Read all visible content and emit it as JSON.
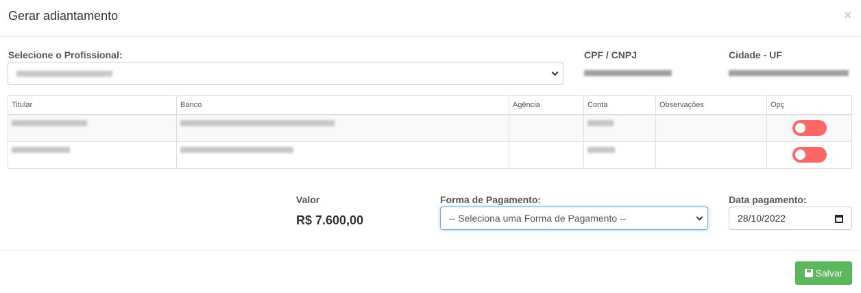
{
  "modal": {
    "title": "Gerar adiantamento",
    "close": "×"
  },
  "professional": {
    "label": "Selecione o Profissional:"
  },
  "cpf": {
    "label": "CPF / CNPJ"
  },
  "city": {
    "label": "Cidade - UF"
  },
  "table": {
    "headers": [
      "Titular",
      "Banco",
      "Agência",
      "Conta",
      "Observações",
      "Opç"
    ],
    "rows": [
      {
        "toggle_on": false
      },
      {
        "toggle_on": false
      }
    ]
  },
  "valor": {
    "label": "Valor",
    "value": "R$ 7.600,00"
  },
  "payment": {
    "label": "Forma de Pagamento:",
    "selected": "-- Seleciona uma Forma de Pagamento --"
  },
  "date": {
    "label": "Data pagamento:",
    "value": "28/10/2022"
  },
  "footer": {
    "save": "Salvar"
  },
  "colors": {
    "toggle_off": "#ff6666",
    "save": "#5cb85c",
    "focus": "#66afe9"
  }
}
